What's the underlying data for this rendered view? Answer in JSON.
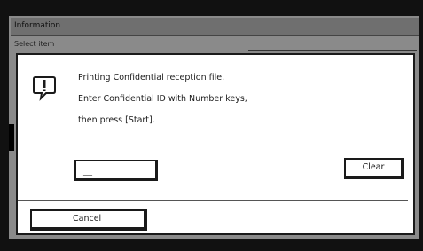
{
  "window": {
    "title": "Information",
    "subtitle": "Select item"
  },
  "dialog": {
    "icon": "exclamation-icon",
    "message_lines": [
      "Printing Confidential reception file.",
      "Enter Confidential ID with Number keys,",
      "then press [Start]."
    ],
    "id_input_value": "__",
    "clear_label": "Clear",
    "cancel_label": "Cancel"
  },
  "colors": {
    "bezel": "#111111",
    "background_panel": "#8a8a8a",
    "dialog_bg": "#ffffff",
    "text": "#1a1a1a"
  }
}
